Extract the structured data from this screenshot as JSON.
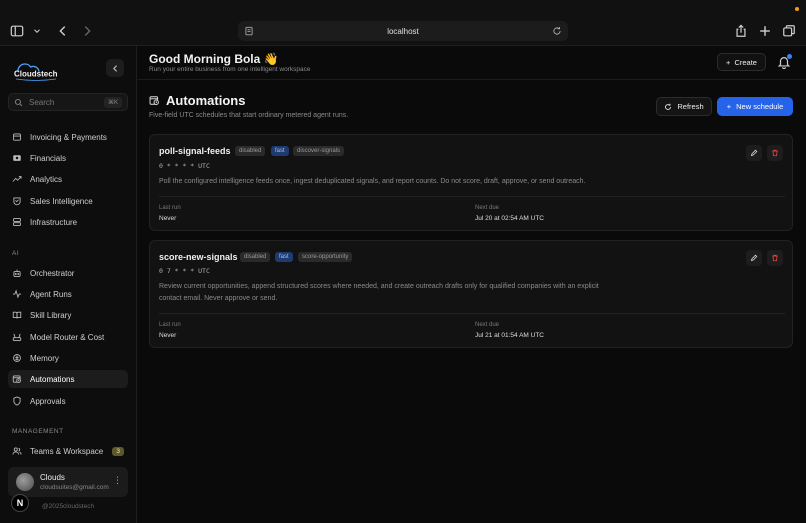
{
  "browser": {
    "url": "localhost"
  },
  "sidebar": {
    "brand": "Cloudstech",
    "search_placeholder": "Search",
    "search_shortcut": "⌘K",
    "items_top": [
      {
        "label": "Invoicing & Payments",
        "icon": "invoice-icon"
      },
      {
        "label": "Financials",
        "icon": "wallet-icon"
      },
      {
        "label": "Analytics",
        "icon": "trend-icon"
      },
      {
        "label": "Sales Intelligence",
        "icon": "target-icon"
      },
      {
        "label": "Infrastructure",
        "icon": "server-icon"
      }
    ],
    "section_ai": "AI",
    "items_ai": [
      {
        "label": "Orchestrator",
        "icon": "bot-icon"
      },
      {
        "label": "Agent Runs",
        "icon": "activity-icon"
      },
      {
        "label": "Skill Library",
        "icon": "book-icon"
      },
      {
        "label": "Model Router & Cost",
        "icon": "router-icon"
      },
      {
        "label": "Memory",
        "icon": "brain-icon"
      },
      {
        "label": "Automations",
        "icon": "calendar-clock-icon",
        "active": true
      },
      {
        "label": "Approvals",
        "icon": "shield-icon"
      }
    ],
    "section_management": "MANAGEMENT",
    "items_management": [
      {
        "label": "Teams & Workspace",
        "icon": "users-icon",
        "badge": "3"
      }
    ],
    "user": {
      "name": "Clouds",
      "email": "cloudsuites@gmail.com"
    },
    "copyright": "@2025cloudstech"
  },
  "header": {
    "greeting": "Good Morning Bola 👋",
    "subtitle": "Run your entire business from one intelligent workspace",
    "create_label": "Create"
  },
  "page": {
    "title": "Automations",
    "subtitle": "Five-field UTC schedules that start ordinary metered agent runs.",
    "refresh_label": "Refresh",
    "new_label": "New schedule"
  },
  "schedules": [
    {
      "name": "poll-signal-feeds",
      "tags": [
        "disabled",
        "fast",
        "discover-signals"
      ],
      "cron": "0 * * * * UTC",
      "description_lines": [
        "Poll the configured intelligence feeds once, ingest deduplicated signals, and report counts. Do not score, draft, approve, or send outreach."
      ],
      "last_run_label": "Last run",
      "last_run": "Never",
      "next_due_label": "Next due",
      "next_due": "Jul 20 at 02:54 AM UTC"
    },
    {
      "name": "score-new-signals",
      "tags": [
        "disabled",
        "fast",
        "score-opportunity"
      ],
      "cron": "0 7 * * * UTC",
      "description_lines": [
        "Review current opportunities, append structured scores where needed, and create outreach drafts only for qualified companies with an explicit",
        "contact email. Never approve or send."
      ],
      "last_run_label": "Last run",
      "last_run": "Never",
      "next_due_label": "Next due",
      "next_due": "Jul 21 at 01:54 AM UTC"
    }
  ]
}
